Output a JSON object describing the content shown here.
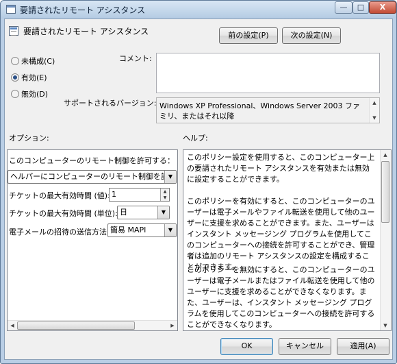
{
  "window": {
    "title": "要請されたリモート アシスタンス",
    "minimize_glyph": "—",
    "maximize_glyph": "□",
    "close_glyph": "X"
  },
  "header": {
    "policy_name": "要請されたリモート アシスタンス",
    "prev_button": "前の設定(P)",
    "next_button": "次の設定(N)"
  },
  "state": {
    "options": [
      {
        "label": "未構成(C)",
        "selected": false
      },
      {
        "label": "有効(E)",
        "selected": true
      },
      {
        "label": "無効(D)",
        "selected": false
      }
    ]
  },
  "comment": {
    "label": "コメント:",
    "value": ""
  },
  "supported": {
    "label": "サポートされるバージョン:",
    "value": "Windows XP Professional、Windows Server 2003 ファミリ、またはそれ以降"
  },
  "options_panel": {
    "heading": "オプション:",
    "permit_label": "このコンピューターのリモート制御を許可する：",
    "permit_value": "ヘルパーにコンピューターのリモート制御を許可す",
    "max_ticket_value_label": "チケットの最大有効時間 (値):",
    "max_ticket_value": "1",
    "max_ticket_unit_label": "チケットの最大有効時間 (単位):",
    "max_ticket_unit": "日",
    "email_method_label": "電子メールの招待の送信方法:",
    "email_method": "簡易 MAPI"
  },
  "help_panel": {
    "heading": "ヘルプ:",
    "paragraphs": [
      "このポリシー設定を使用すると、このコンピューター上の要請されたリモート アシスタンスを有効または無効に設定することができます。",
      "このポリシーを有効にすると、このコンピューターのユーザーは電子メールやファイル転送を使用して他のユーザーに支援を求めることができます。また、ユーザーはインスタント メッセージング プログラムを使用してこのコンピューターへの接続を許可することができ、管理者は追加のリモート アシスタンスの設定を構成することができます。",
      "このポリシーを無効にすると、このコンピューターのユーザーは電子メールまたはファイル転送を使用して他のユーザーに支援を求めることができなくなります。また、ユーザーは、インスタント メッセージング プログラムを使用してこのコンピューターへの接続を許可することができなくなります。"
    ]
  },
  "footer": {
    "ok": "OK",
    "cancel": "キャンセル",
    "apply": "適用(A)"
  }
}
